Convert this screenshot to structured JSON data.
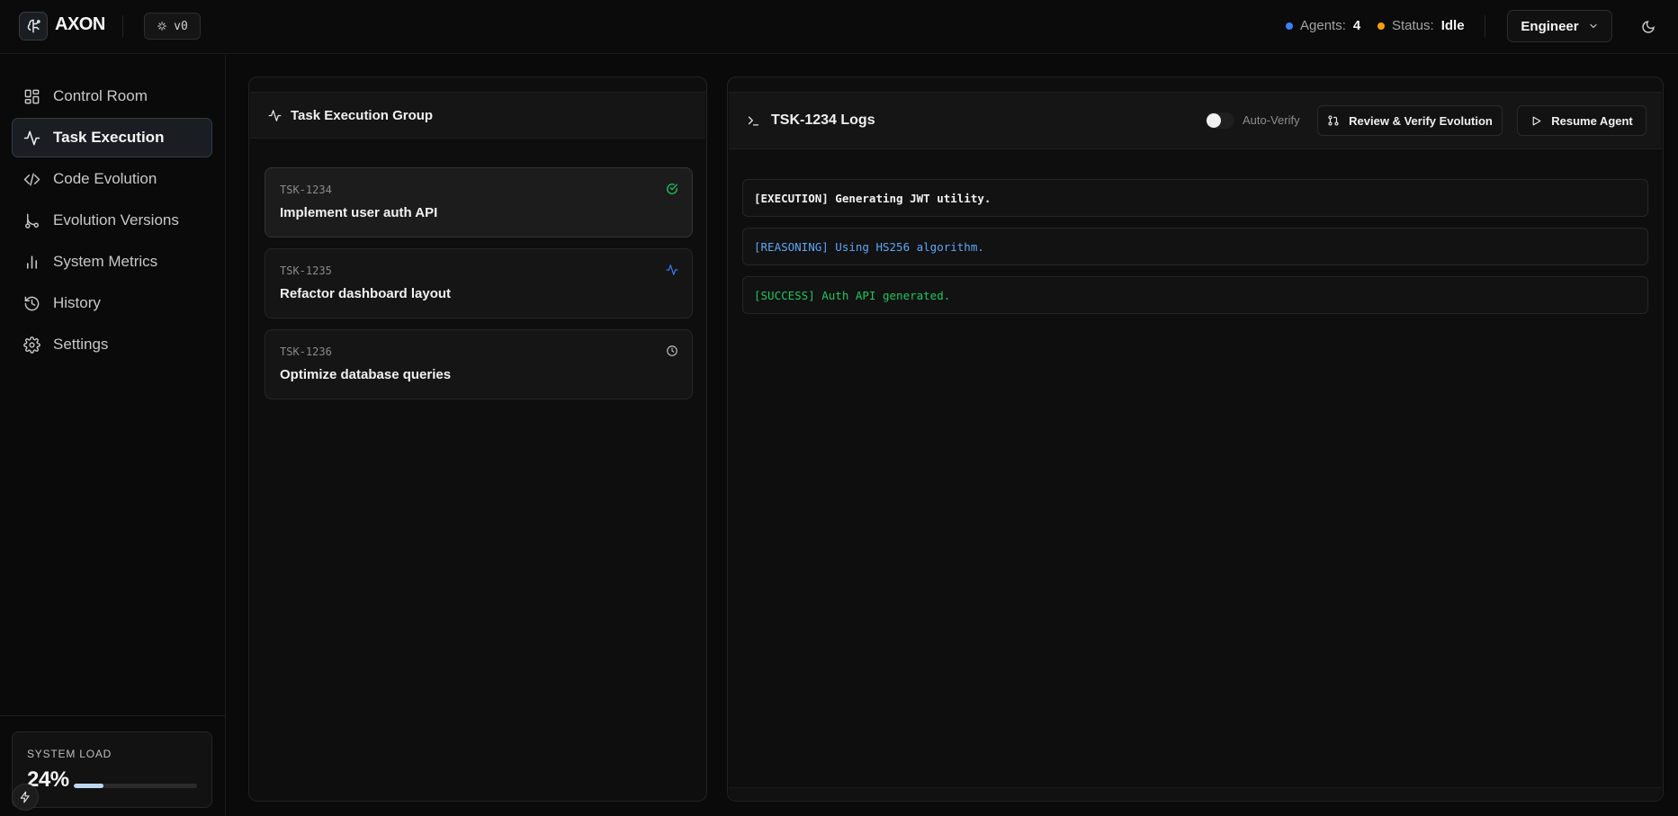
{
  "header": {
    "brand": "AXON",
    "version": "v0",
    "agents_label": "Agents:",
    "agents_value": "4",
    "status_label": "Status:",
    "status_value": "Idle",
    "role": "Engineer"
  },
  "colors": {
    "agents_dot": "#3b82f6",
    "status_dot": "#f59e0b",
    "success": "#22c55e",
    "reasoning": "#5fa6f5",
    "running": "#3b82f6"
  },
  "sidebar": {
    "items": [
      {
        "label": "Control Room",
        "icon": "grid-icon"
      },
      {
        "label": "Task Execution",
        "icon": "activity-icon"
      },
      {
        "label": "Code Evolution",
        "icon": "code-icon"
      },
      {
        "label": "Evolution Versions",
        "icon": "git-branch-icon"
      },
      {
        "label": "System Metrics",
        "icon": "bar-chart-icon"
      },
      {
        "label": "History",
        "icon": "history-icon"
      },
      {
        "label": "Settings",
        "icon": "gear-icon"
      }
    ],
    "active_index": 1,
    "system_load": {
      "title": "SYSTEM LOAD",
      "value": "24%",
      "fraction": 0.24
    }
  },
  "tasks": {
    "title": "Task Execution Group",
    "items": [
      {
        "id": "TSK-1234",
        "title": "Implement user auth API",
        "status": "completed"
      },
      {
        "id": "TSK-1235",
        "title": "Refactor dashboard layout",
        "status": "running"
      },
      {
        "id": "TSK-1236",
        "title": "Optimize database queries",
        "status": "pending"
      }
    ]
  },
  "logs": {
    "title": "TSK-1234 Logs",
    "auto_verify_label": "Auto-Verify",
    "review_button": "Review & Verify Evolution",
    "resume_button": "Resume Agent",
    "lines": [
      {
        "text": "[EXECUTION] Generating JWT utility.",
        "kind": "execution"
      },
      {
        "text": "[REASONING] Using HS256 algorithm.",
        "kind": "reasoning"
      },
      {
        "text": "[SUCCESS] Auth API generated.",
        "kind": "success"
      }
    ]
  }
}
